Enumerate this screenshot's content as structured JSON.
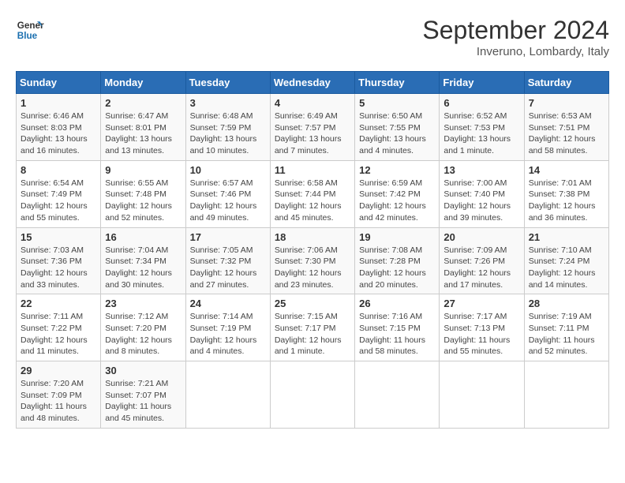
{
  "logo": {
    "line1": "General",
    "line2": "Blue"
  },
  "calendar": {
    "title": "September 2024",
    "subtitle": "Inveruno, Lombardy, Italy"
  },
  "headers": [
    "Sunday",
    "Monday",
    "Tuesday",
    "Wednesday",
    "Thursday",
    "Friday",
    "Saturday"
  ],
  "weeks": [
    [
      {
        "day": "1",
        "info": "Sunrise: 6:46 AM\nSunset: 8:03 PM\nDaylight: 13 hours and 16 minutes."
      },
      {
        "day": "2",
        "info": "Sunrise: 6:47 AM\nSunset: 8:01 PM\nDaylight: 13 hours and 13 minutes."
      },
      {
        "day": "3",
        "info": "Sunrise: 6:48 AM\nSunset: 7:59 PM\nDaylight: 13 hours and 10 minutes."
      },
      {
        "day": "4",
        "info": "Sunrise: 6:49 AM\nSunset: 7:57 PM\nDaylight: 13 hours and 7 minutes."
      },
      {
        "day": "5",
        "info": "Sunrise: 6:50 AM\nSunset: 7:55 PM\nDaylight: 13 hours and 4 minutes."
      },
      {
        "day": "6",
        "info": "Sunrise: 6:52 AM\nSunset: 7:53 PM\nDaylight: 13 hours and 1 minute."
      },
      {
        "day": "7",
        "info": "Sunrise: 6:53 AM\nSunset: 7:51 PM\nDaylight: 12 hours and 58 minutes."
      }
    ],
    [
      {
        "day": "8",
        "info": "Sunrise: 6:54 AM\nSunset: 7:49 PM\nDaylight: 12 hours and 55 minutes."
      },
      {
        "day": "9",
        "info": "Sunrise: 6:55 AM\nSunset: 7:48 PM\nDaylight: 12 hours and 52 minutes."
      },
      {
        "day": "10",
        "info": "Sunrise: 6:57 AM\nSunset: 7:46 PM\nDaylight: 12 hours and 49 minutes."
      },
      {
        "day": "11",
        "info": "Sunrise: 6:58 AM\nSunset: 7:44 PM\nDaylight: 12 hours and 45 minutes."
      },
      {
        "day": "12",
        "info": "Sunrise: 6:59 AM\nSunset: 7:42 PM\nDaylight: 12 hours and 42 minutes."
      },
      {
        "day": "13",
        "info": "Sunrise: 7:00 AM\nSunset: 7:40 PM\nDaylight: 12 hours and 39 minutes."
      },
      {
        "day": "14",
        "info": "Sunrise: 7:01 AM\nSunset: 7:38 PM\nDaylight: 12 hours and 36 minutes."
      }
    ],
    [
      {
        "day": "15",
        "info": "Sunrise: 7:03 AM\nSunset: 7:36 PM\nDaylight: 12 hours and 33 minutes."
      },
      {
        "day": "16",
        "info": "Sunrise: 7:04 AM\nSunset: 7:34 PM\nDaylight: 12 hours and 30 minutes."
      },
      {
        "day": "17",
        "info": "Sunrise: 7:05 AM\nSunset: 7:32 PM\nDaylight: 12 hours and 27 minutes."
      },
      {
        "day": "18",
        "info": "Sunrise: 7:06 AM\nSunset: 7:30 PM\nDaylight: 12 hours and 23 minutes."
      },
      {
        "day": "19",
        "info": "Sunrise: 7:08 AM\nSunset: 7:28 PM\nDaylight: 12 hours and 20 minutes."
      },
      {
        "day": "20",
        "info": "Sunrise: 7:09 AM\nSunset: 7:26 PM\nDaylight: 12 hours and 17 minutes."
      },
      {
        "day": "21",
        "info": "Sunrise: 7:10 AM\nSunset: 7:24 PM\nDaylight: 12 hours and 14 minutes."
      }
    ],
    [
      {
        "day": "22",
        "info": "Sunrise: 7:11 AM\nSunset: 7:22 PM\nDaylight: 12 hours and 11 minutes."
      },
      {
        "day": "23",
        "info": "Sunrise: 7:12 AM\nSunset: 7:20 PM\nDaylight: 12 hours and 8 minutes."
      },
      {
        "day": "24",
        "info": "Sunrise: 7:14 AM\nSunset: 7:19 PM\nDaylight: 12 hours and 4 minutes."
      },
      {
        "day": "25",
        "info": "Sunrise: 7:15 AM\nSunset: 7:17 PM\nDaylight: 12 hours and 1 minute."
      },
      {
        "day": "26",
        "info": "Sunrise: 7:16 AM\nSunset: 7:15 PM\nDaylight: 11 hours and 58 minutes."
      },
      {
        "day": "27",
        "info": "Sunrise: 7:17 AM\nSunset: 7:13 PM\nDaylight: 11 hours and 55 minutes."
      },
      {
        "day": "28",
        "info": "Sunrise: 7:19 AM\nSunset: 7:11 PM\nDaylight: 11 hours and 52 minutes."
      }
    ],
    [
      {
        "day": "29",
        "info": "Sunrise: 7:20 AM\nSunset: 7:09 PM\nDaylight: 11 hours and 48 minutes."
      },
      {
        "day": "30",
        "info": "Sunrise: 7:21 AM\nSunset: 7:07 PM\nDaylight: 11 hours and 45 minutes."
      },
      {
        "day": "",
        "info": ""
      },
      {
        "day": "",
        "info": ""
      },
      {
        "day": "",
        "info": ""
      },
      {
        "day": "",
        "info": ""
      },
      {
        "day": "",
        "info": ""
      }
    ]
  ]
}
